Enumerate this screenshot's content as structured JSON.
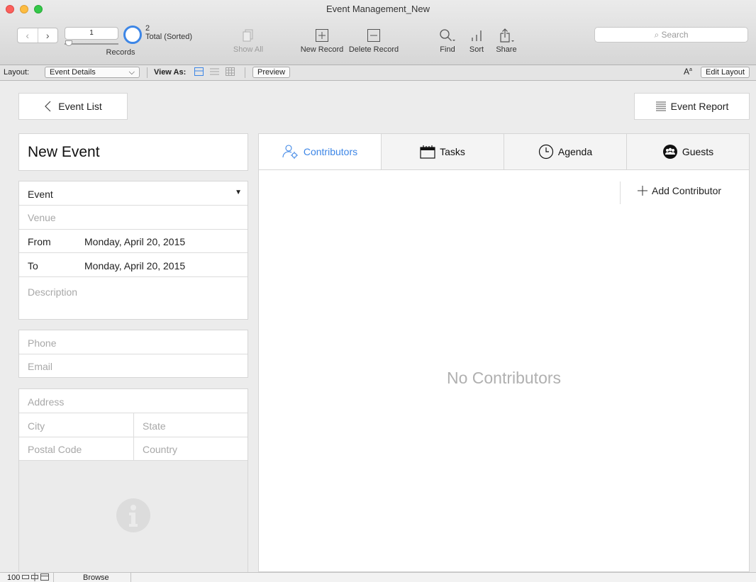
{
  "window": {
    "title": "Event Management_New"
  },
  "toolbar": {
    "record_number": "1",
    "records_label": "Records",
    "found_count": "2",
    "total_label": "Total (Sorted)",
    "show_all": "Show All",
    "new_record": "New Record",
    "delete_record": "Delete Record",
    "find": "Find",
    "sort": "Sort",
    "share": "Share",
    "search_placeholder": "Search"
  },
  "layoutbar": {
    "layout_label": "Layout:",
    "layout_value": "Event Details",
    "view_as_label": "View As:",
    "preview": "Preview",
    "edit_layout": "Edit Layout"
  },
  "nav": {
    "back_button": "Event List",
    "report_button": "Event Report"
  },
  "event": {
    "title": "New Event",
    "type_value": "Event",
    "venue_placeholder": "Venue",
    "from_label": "From",
    "from_value": "Monday, April 20, 2015",
    "to_label": "To",
    "to_value": "Monday, April 20, 2015",
    "description_placeholder": "Description",
    "phone_placeholder": "Phone",
    "email_placeholder": "Email",
    "address_placeholder": "Address",
    "city_placeholder": "City",
    "state_placeholder": "State",
    "postal_placeholder": "Postal Code",
    "country_placeholder": "Country"
  },
  "tabs": [
    {
      "label": "Contributors",
      "icon": "contributors-icon",
      "active": true
    },
    {
      "label": "Tasks",
      "icon": "calendar-icon",
      "active": false
    },
    {
      "label": "Agenda",
      "icon": "clock-icon",
      "active": false
    },
    {
      "label": "Guests",
      "icon": "people-icon",
      "active": false
    }
  ],
  "portal": {
    "add_button": "Add Contributor",
    "empty_message": "No Contributors"
  },
  "statusbar": {
    "zoom": "100",
    "mode": "Browse"
  },
  "colors": {
    "accent": "#3d86e6",
    "close": "#fc605c",
    "minimize": "#fdbc40",
    "maximize": "#34c84a"
  }
}
